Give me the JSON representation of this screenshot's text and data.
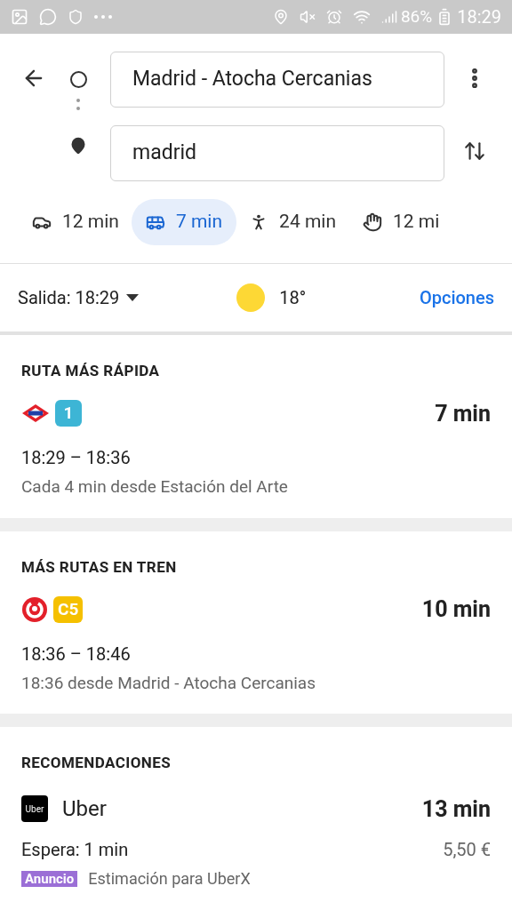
{
  "status_bar": {
    "battery": "86%",
    "time": "18:29"
  },
  "route": {
    "origin": "Madrid - Atocha Cercanias",
    "destination": "madrid"
  },
  "modes": [
    {
      "kind": "car",
      "label": "12 min",
      "selected": false
    },
    {
      "kind": "bus",
      "label": "7 min",
      "selected": true
    },
    {
      "kind": "walk",
      "label": "24 min",
      "selected": false
    },
    {
      "kind": "ride",
      "label": "12 mi",
      "selected": false
    }
  ],
  "options_bar": {
    "departure": "Salida: 18:29",
    "temperature": "18°",
    "options": "Opciones"
  },
  "sections": [
    {
      "title": "RUTA MÁS RÁPIDA",
      "routes": [
        {
          "kind": "metro",
          "line": "1",
          "color": "#3db5d5",
          "duration": "7 min",
          "times": "18:29 – 18:36",
          "detail": "Cada 4 min desde Estación del Arte"
        }
      ]
    },
    {
      "title": "MÁS RUTAS EN TREN",
      "routes": [
        {
          "kind": "train",
          "line": "C5",
          "color": "#f5c000",
          "duration": "10 min",
          "times": "18:36 – 18:46",
          "detail": "18:36 desde Madrid - Atocha Cercanias"
        }
      ]
    }
  ],
  "recommendations": {
    "title": "RECOMENDACIONES",
    "logo_text": "Uber",
    "name": "Uber",
    "duration": "13 min",
    "wait": "Espera: 1 min",
    "price": "5,50 €",
    "ad_badge": "Anuncio",
    "ad_text": "Estimación para UberX"
  }
}
